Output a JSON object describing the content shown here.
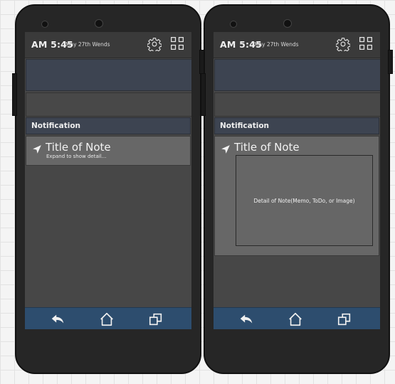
{
  "screens": [
    {
      "status": {
        "time": "AM 5:45",
        "date": "May 27th Wends"
      },
      "notification_header": "Notification",
      "note": {
        "title": "Title of Note",
        "hint": "Expand to show detail..."
      }
    },
    {
      "status": {
        "time": "AM 5:45",
        "date": "May 27th Wends"
      },
      "notification_header": "Notification",
      "note": {
        "title": "Title of Note",
        "detail": "Detail of Note(Memo, ToDo, or Image)"
      }
    }
  ],
  "icons": {
    "settings": "gear-icon",
    "apps": "grid-icon",
    "note": "navigation-arrow-icon",
    "back": "back-arrow-icon",
    "home": "home-icon",
    "recents": "recent-apps-icon"
  },
  "colors": {
    "status_bar": "#3a3a3a",
    "notification_header": "#3d4451",
    "nav_bar": "#2d4d6e",
    "screen": "#474747",
    "note_card": "#676767"
  }
}
